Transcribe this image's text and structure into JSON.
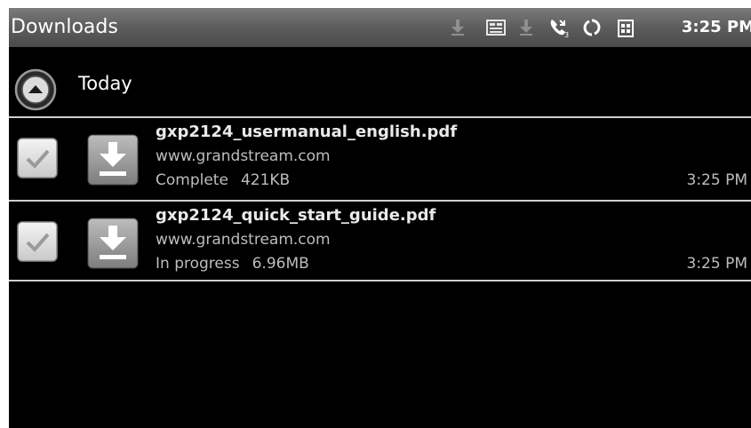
{
  "app": {
    "title": "Downloads"
  },
  "status_bar": {
    "time": "3:25 PM",
    "icons": [
      "download-arrow-icon",
      "voicemail-icon",
      "download-arrow-icon",
      "missed-call-icon",
      "sync-icon",
      "sim-card-icon"
    ]
  },
  "group": {
    "label": "Today",
    "expand_icon": "chevron-up-icon"
  },
  "downloads": [
    {
      "filename": "gxp2124_usermanual_english.pdf",
      "source": "www.grandstream.com",
      "status": "Complete",
      "size": "421KB",
      "time": "3:25 PM",
      "checked": true,
      "icon": "download-icon"
    },
    {
      "filename": "gxp2124_quick_start_guide.pdf",
      "source": "www.grandstream.com",
      "status": "In progress",
      "size": "6.96MB",
      "time": "3:25 PM",
      "checked": true,
      "icon": "download-icon"
    }
  ],
  "colors": {
    "titlebar_top": "#7b7b7b",
    "titlebar_bottom": "#4b4b4b",
    "background": "#000000",
    "primary_text": "#e9e9e9",
    "secondary_text": "#bdbdbd",
    "divider": "#cfcfcf"
  }
}
